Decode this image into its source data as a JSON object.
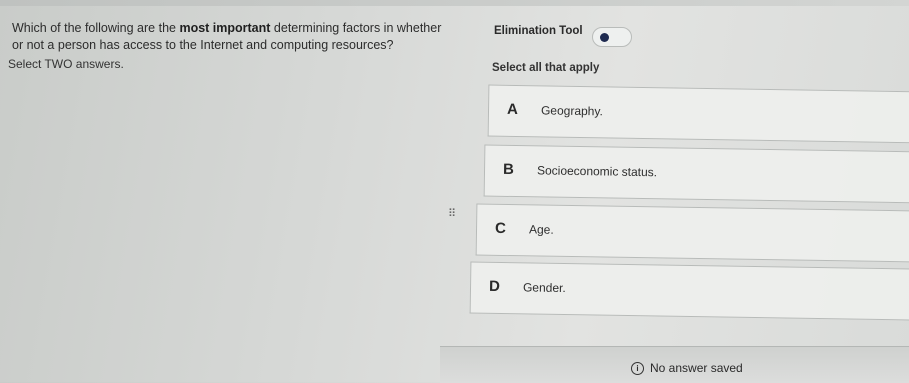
{
  "question": {
    "text_before": "Which of the following are the ",
    "text_bold": "most important",
    "text_after": " determining factors in whether or not a person has access to the Internet and computing resources?",
    "instruction": "Select TWO answers."
  },
  "elimination_tool": {
    "label": "Elimination Tool"
  },
  "select_all_label": "Select all that apply",
  "options": [
    {
      "letter": "A",
      "text": "Geography."
    },
    {
      "letter": "B",
      "text": "Socioeconomic status."
    },
    {
      "letter": "C",
      "text": "Age."
    },
    {
      "letter": "D",
      "text": "Gender."
    }
  ],
  "status": {
    "icon": "info-icon",
    "text": "No answer saved"
  }
}
